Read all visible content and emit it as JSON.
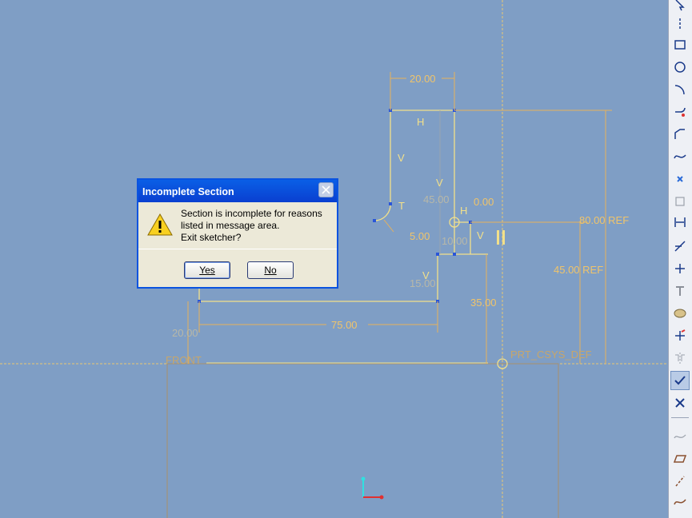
{
  "dialog": {
    "title": "Incomplete Section",
    "message": "Section is incomplete for reasons\nlisted in message area.\nExit sketcher?",
    "yes_label": "Yes",
    "no_label": "No"
  },
  "sketch": {
    "dims": {
      "d_top_width": "20.00",
      "d_v45": "45.00",
      "d_0": "0.00",
      "d_80ref": "80.00 REF",
      "d_45ref": "45.00 REF",
      "d_5": "5.00",
      "d_10": "10.00",
      "d_15": "15.00",
      "d_35": "35.00",
      "d_75": "75.00",
      "d_20_left": "20.00"
    },
    "constraints": {
      "h1": "H",
      "v1": "V",
      "v2": "V",
      "t1": "T",
      "h2": "H",
      "v3": "V",
      "v4": "V"
    },
    "labels": {
      "front": "FRONT",
      "csys": "PRT_CSYS_DEF"
    }
  },
  "toolbar": {
    "icons": [
      "select-arrow-icon",
      "centerline-icon",
      "rectangle-icon",
      "circle-icon",
      "arc-icon",
      "fillet-icon",
      "chamfer-icon",
      "spline-icon",
      "point-icon",
      "offset-icon",
      "dimension-icon",
      "modify-icon",
      "constrain-icon",
      "text-icon",
      "palette-icon",
      "trim-icon",
      "mirror-icon",
      "done-check-icon",
      "quit-x-icon",
      "hidden-line-icon",
      "plane-icon",
      "axis-icon",
      "curve-icon"
    ]
  },
  "colors": {
    "background": "#7f9ec5",
    "sketch": "#f2e08a",
    "dim": "#e7b15a",
    "datum": "#c7a66b"
  }
}
